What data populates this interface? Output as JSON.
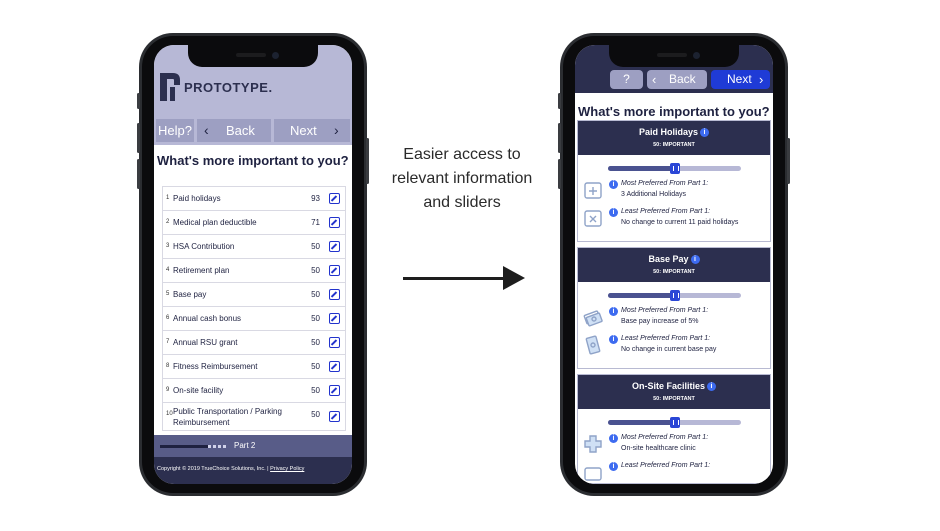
{
  "left_screen": {
    "logo_text": "PROTOTYPE.",
    "nav": {
      "help_label": "Help?",
      "back_label": "Back",
      "next_label": "Next"
    },
    "question": "What's more important to you?",
    "items": [
      {
        "num": "1",
        "label": "Paid holidays",
        "value": "93"
      },
      {
        "num": "2",
        "label": "Medical plan deductible",
        "value": "71"
      },
      {
        "num": "3",
        "label": "HSA Contribution",
        "value": "50"
      },
      {
        "num": "4",
        "label": "Retirement plan",
        "value": "50"
      },
      {
        "num": "5",
        "label": "Base pay",
        "value": "50"
      },
      {
        "num": "6",
        "label": "Annual cash bonus",
        "value": "50"
      },
      {
        "num": "7",
        "label": "Annual RSU grant",
        "value": "50"
      },
      {
        "num": "8",
        "label": "Fitness Reimbursement",
        "value": "50"
      },
      {
        "num": "9",
        "label": "On-site facility",
        "value": "50"
      },
      {
        "num": "10",
        "label": "Public Transportation / Parking Reimbursement",
        "value": "50"
      }
    ],
    "progress_label": "Part 2",
    "copyright": "Copyright © 2019 TrueChoice Solutions, Inc. | ",
    "privacy_link": "Privacy Policy"
  },
  "caption": {
    "line1": "Easier access to",
    "line2": "relevant information",
    "line3": "and sliders"
  },
  "right_screen": {
    "nav": {
      "help_label": "?",
      "back_label": "Back",
      "next_label": "Next"
    },
    "question": "What's more important to you?",
    "cards": [
      {
        "title": "Paid Holidays",
        "level": "50: IMPORTANT",
        "slider_value": 50,
        "most_head": "Most Preferred From Part 1:",
        "most_value": "3 Additional Holidays",
        "least_head": "Least Preferred From Part 1:",
        "least_value": "No change to current 11 paid holidays"
      },
      {
        "title": "Base Pay",
        "level": "50: IMPORTANT",
        "slider_value": 50,
        "most_head": "Most Preferred From Part 1:",
        "most_value": "Base pay increase of 5%",
        "least_head": "Least Preferred From Part 1:",
        "least_value": "No change in current base pay"
      },
      {
        "title": "On-Site Facilities",
        "level": "50: IMPORTANT",
        "slider_value": 50,
        "most_head": "Most Preferred From Part 1:",
        "most_value": "On-site healthcare clinic",
        "least_head": "Least Preferred From Part 1:",
        "least_value": ""
      }
    ]
  },
  "colors": {
    "header_lavender": "#b7b8d6",
    "navy": "#2c2f4f",
    "accent_blue": "#1f3bd6",
    "button_gray": "#9d9fc2"
  }
}
